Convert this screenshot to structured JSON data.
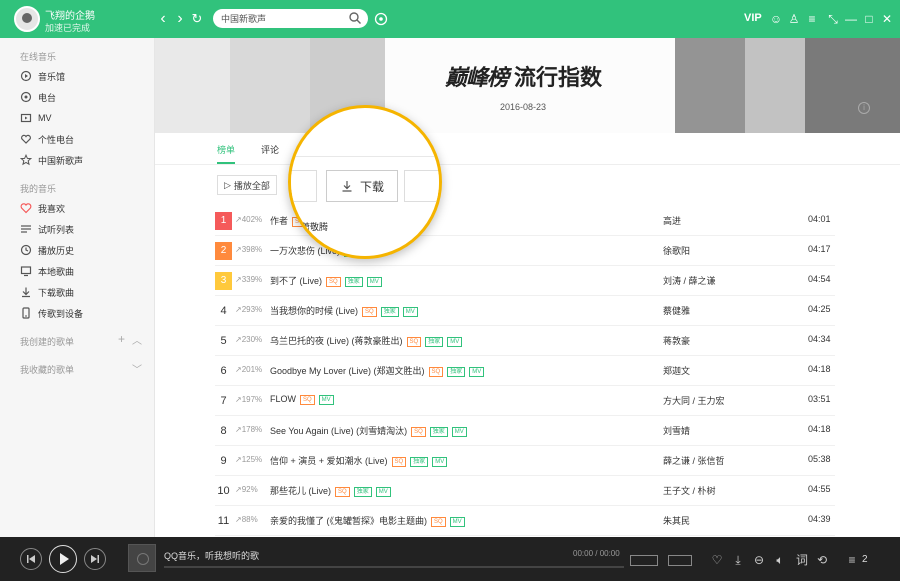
{
  "window": {
    "user": {
      "name": "飞翔的企鹅",
      "status": "加速已完成"
    },
    "search": {
      "value": "中国新歌声"
    },
    "vip_label": "VIP"
  },
  "sidebar": {
    "sections": [
      {
        "title": "在线音乐",
        "items": [
          "音乐馆",
          "电台",
          "MV",
          "个性电台",
          "中国新歌声"
        ]
      },
      {
        "title": "我的音乐",
        "items": [
          "我喜欢",
          "试听列表",
          "播放历史",
          "本地歌曲",
          "下载歌曲",
          "传歌到设备"
        ]
      },
      {
        "title": "我创建的歌单",
        "items": []
      },
      {
        "title": "我收藏的歌单",
        "items": []
      }
    ]
  },
  "banner": {
    "logo_mark": "巅峰榜",
    "title": "流行指数",
    "date": "2016-08-23"
  },
  "tabs": [
    "榜单",
    "评论"
  ],
  "actions": {
    "play_all": "播放全部"
  },
  "magnifier": {
    "download": "下载",
    "row1_partial": "萧敬腾",
    "row2_partial": "徐歌阳"
  },
  "songs": [
    {
      "rank": "1",
      "change": "402%",
      "title": "作者",
      "artist": "高进",
      "duration": "04:01",
      "badges": [
        "SQ"
      ]
    },
    {
      "rank": "2",
      "change": "398%",
      "title": "一万次悲伤 (Live)",
      "artist": "徐歌阳",
      "duration": "04:17",
      "badges": [
        "独家",
        "MV"
      ]
    },
    {
      "rank": "3",
      "change": "339%",
      "title": "到不了 (Live)",
      "artist": "刘涛 / 薛之谦",
      "duration": "04:54",
      "badges": [
        "SQ",
        "独家",
        "MV"
      ]
    },
    {
      "rank": "4",
      "change": "293%",
      "title": "当我想你的时候 (Live)",
      "artist": "蔡健雅",
      "duration": "04:25",
      "badges": [
        "SQ",
        "独家",
        "MV"
      ]
    },
    {
      "rank": "5",
      "change": "230%",
      "title": "乌兰巴托的夜 (Live) (蒋敦豪胜出)",
      "artist": "蒋敦豪",
      "duration": "04:34",
      "badges": [
        "SQ",
        "独家",
        "MV"
      ]
    },
    {
      "rank": "6",
      "change": "201%",
      "title": "Goodbye My Lover (Live) (郑迦文胜出)",
      "artist": "郑迦文",
      "duration": "04:18",
      "badges": [
        "SQ",
        "独家",
        "MV"
      ]
    },
    {
      "rank": "7",
      "change": "197%",
      "title": "FLOW",
      "artist": "方大同 / 王力宏",
      "duration": "03:51",
      "badges": [
        "SQ",
        "MV"
      ]
    },
    {
      "rank": "8",
      "change": "178%",
      "title": "See You Again (Live) (刘雪婧淘汰)",
      "artist": "刘雪婧",
      "duration": "04:18",
      "badges": [
        "SQ",
        "独家",
        "MV"
      ]
    },
    {
      "rank": "9",
      "change": "125%",
      "title": "信仰 + 演员 + 爱如潮水 (Live)",
      "artist": "薛之谦 / 张信哲",
      "duration": "05:38",
      "badges": [
        "SQ",
        "独家",
        "MV"
      ]
    },
    {
      "rank": "10",
      "change": "92%",
      "title": "那些花儿 (Live)",
      "artist": "王子文 / 朴树",
      "duration": "04:55",
      "badges": [
        "SQ",
        "独家",
        "MV"
      ]
    },
    {
      "rank": "11",
      "change": "88%",
      "title": "亲爱的我懂了 (《鬼罐暂探》电影主题曲)",
      "artist": "朱其民",
      "duration": "04:39",
      "badges": [
        "SQ",
        "MV"
      ]
    }
  ],
  "player": {
    "now_playing": "QQ音乐，听我想听的歌",
    "time": "00:00 / 00:00",
    "queue_count": "2",
    "mode1": "",
    "mode2": ""
  },
  "colors": {
    "accent": "#31c27c",
    "player_bg": "#222222",
    "magnifier_ring": "#f5b400"
  }
}
